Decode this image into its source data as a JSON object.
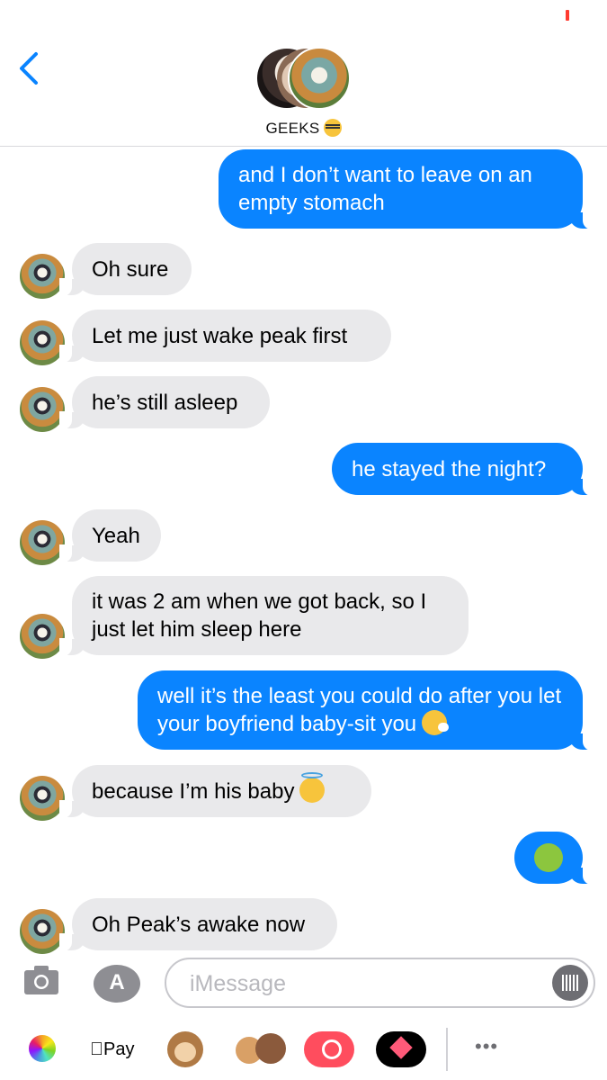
{
  "header": {
    "group_name": "GEEKS",
    "group_emoji": "nerd-face-emoji"
  },
  "composer": {
    "placeholder": "iMessage"
  },
  "tray": {
    "apple_pay_label": "Pay"
  },
  "messages": [
    {
      "side": "sent",
      "text": "and I don’t want to leave on an empty stomach"
    },
    {
      "side": "received",
      "text": "Oh sure"
    },
    {
      "side": "received",
      "text": "Let me just wake peak first"
    },
    {
      "side": "received",
      "text": "he’s still asleep"
    },
    {
      "side": "sent",
      "text": "he stayed the night?"
    },
    {
      "side": "received",
      "text": "Yeah"
    },
    {
      "side": "received",
      "text": "it was 2 am when we got back, so I just let him sleep here"
    },
    {
      "side": "sent",
      "text": "well it’s the least you could do after you let your boyfriend baby-sit you",
      "emoji": "sneezing-face-emoji"
    },
    {
      "side": "received",
      "text": "because I’m his baby",
      "emoji": "smiling-face-with-halo-emoji"
    },
    {
      "side": "sent",
      "text": "",
      "emoji": "nauseated-face-emoji"
    },
    {
      "side": "received",
      "text": "Oh Peak’s awake now"
    }
  ],
  "colors": {
    "sent_bubble": "#0a84ff",
    "received_bubble": "#e9e9eb",
    "accent": "#0a84ff",
    "battery": "#ff3b30"
  }
}
